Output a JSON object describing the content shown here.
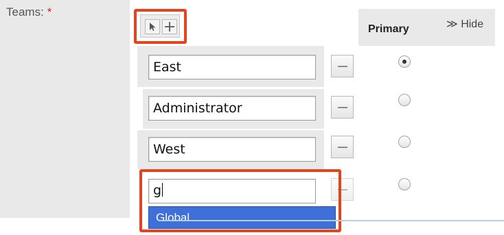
{
  "field": {
    "label": "Teams:",
    "required_mark": "*"
  },
  "toolbar": {
    "select_icon": "arrow-cursor-icon",
    "add_icon": "plus-icon"
  },
  "primary": {
    "header": "Primary",
    "hide_link": "≫ Hide"
  },
  "teams": [
    {
      "value": "East",
      "primary": true
    },
    {
      "value": "Administrator",
      "primary": false
    },
    {
      "value": "West",
      "primary": false
    },
    {
      "value": "g",
      "primary": false
    }
  ],
  "autocomplete": {
    "options": [
      "Global"
    ]
  },
  "colors": {
    "highlight": "#e8421c",
    "dropdown": "#3f6fd8",
    "required": "#d42020"
  }
}
